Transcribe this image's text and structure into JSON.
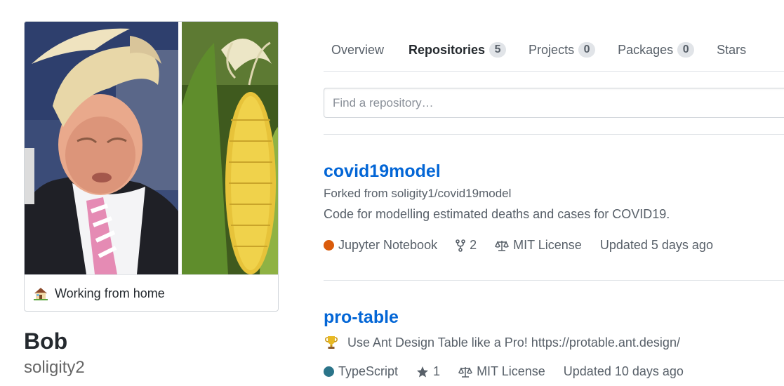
{
  "profile": {
    "status_emoji": "house-emoji",
    "status_text": "Working from home",
    "name": "Bob",
    "login": "soligity2"
  },
  "tabs": [
    {
      "label": "Overview",
      "count": null,
      "selected": false
    },
    {
      "label": "Repositories",
      "count": "5",
      "selected": true
    },
    {
      "label": "Projects",
      "count": "0",
      "selected": false
    },
    {
      "label": "Packages",
      "count": "0",
      "selected": false
    },
    {
      "label": "Stars",
      "count": null,
      "selected": false
    }
  ],
  "search": {
    "placeholder": "Find a repository…",
    "value": ""
  },
  "repos": [
    {
      "name": "covid19model",
      "forked_from": "Forked from soligity1/covid19model",
      "description": "Code for modelling estimated deaths and cases for COVID19.",
      "description_emoji": "",
      "language": "Jupyter Notebook",
      "language_color": "#DA5B0B",
      "counter_icon": "fork-icon",
      "counter": "2",
      "license": "MIT License",
      "updated": "Updated 5 days ago"
    },
    {
      "name": "pro-table",
      "forked_from": "",
      "description": "Use Ant Design Table like a Pro! https://protable.ant.design/",
      "description_emoji": "trophy-emoji",
      "language": "TypeScript",
      "language_color": "#2b7489",
      "counter_icon": "star-icon",
      "counter": "1",
      "license": "MIT License",
      "updated": "Updated 10 days ago"
    }
  ],
  "colors": {
    "link": "#0366d6",
    "tab_underline": "#e36209",
    "muted_text": "#586069",
    "border": "#e1e4e8"
  }
}
